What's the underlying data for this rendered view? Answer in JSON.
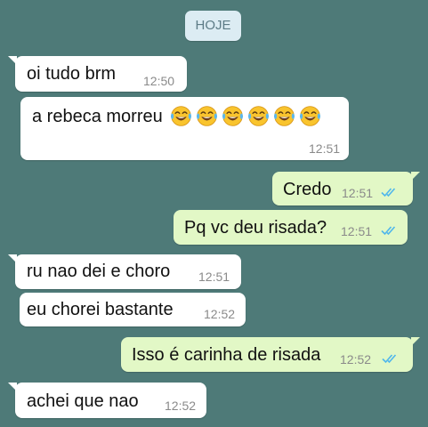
{
  "date_label": "HOJE",
  "messages": [
    {
      "text": "oi tudo brm",
      "time": "12:50"
    },
    {
      "text": "a rebeca morreu",
      "time": "12:51",
      "emoji_name": "face-with-tears-of-joy",
      "emoji_count": 6
    },
    {
      "text": "Credo",
      "time": "12:51",
      "status": "read"
    },
    {
      "text": "Pq vc deu risada?",
      "time": "12:51",
      "status": "read"
    },
    {
      "text": "ru nao dei e choro",
      "time": "12:51"
    },
    {
      "text": "eu chorei bastante",
      "time": "12:52"
    },
    {
      "text": "Isso é carinha de risada",
      "time": "12:52",
      "status": "read"
    },
    {
      "text": "achei que nao",
      "time": "12:52"
    }
  ],
  "colors": {
    "chat_background": "#4e7a78",
    "incoming_bubble": "#ffffff",
    "outgoing_bubble": "#e2f8c6",
    "read_ticks": "#4fb6ec",
    "date_pill": "#dcecf3"
  }
}
